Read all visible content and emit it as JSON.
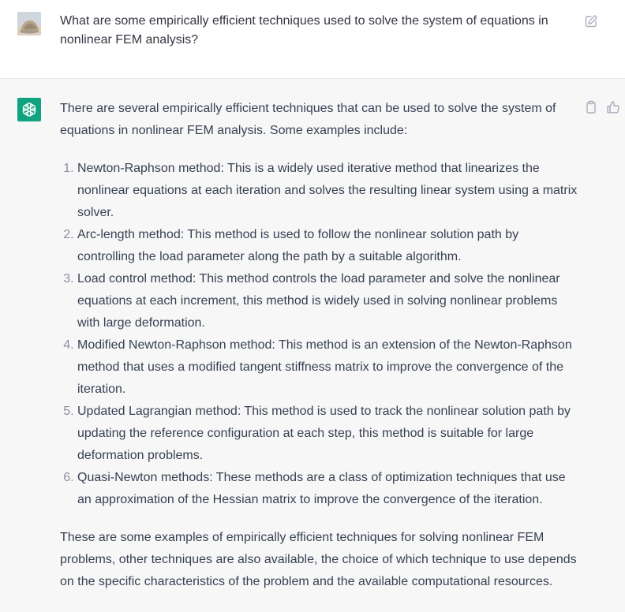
{
  "user_message": {
    "text": "What are some empirically efficient techniques used to solve the system of equations in nonlinear FEM analysis?"
  },
  "assistant_message": {
    "intro": "There are several empirically efficient techniques that can be used to solve the system of equations in nonlinear FEM analysis. Some examples include:",
    "items": [
      "Newton-Raphson method: This is a widely used iterative method that linearizes the nonlinear equations at each iteration and solves the resulting linear system using a matrix solver.",
      "Arc-length method: This method is used to follow the nonlinear solution path by controlling the load parameter along the path by a suitable algorithm.",
      "Load control method: This method controls the load parameter and solve the nonlinear equations at each increment, this method is widely used in solving nonlinear problems with large deformation.",
      "Modified Newton-Raphson method: This method is an extension of the Newton-Raphson method that uses a modified tangent stiffness matrix to improve the convergence of the iteration.",
      "Updated Lagrangian method: This method is used to track the nonlinear solution path by updating the reference configuration at each step, this method is suitable for large deformation problems.",
      "Quasi-Newton methods: These methods are a class of optimization techniques that use an approximation of the Hessian matrix to improve the convergence of the iteration."
    ],
    "conclusion": "These are some examples of empirically efficient techniques for solving nonlinear FEM problems, other techniques are also available, the choice of which technique to use depends on the specific characteristics of the problem and the available computational resources."
  },
  "icons": {
    "user_avatar": "user-avatar-photo",
    "assistant_avatar": "openai-logo-icon",
    "edit": "edit-icon",
    "copy": "clipboard-icon",
    "like": "thumbs-up-icon"
  },
  "colors": {
    "assistant_bg": "#f7f7f8",
    "assistant_avatar_bg": "#10a37f",
    "text": "#374151",
    "icon": "#acacbe"
  }
}
